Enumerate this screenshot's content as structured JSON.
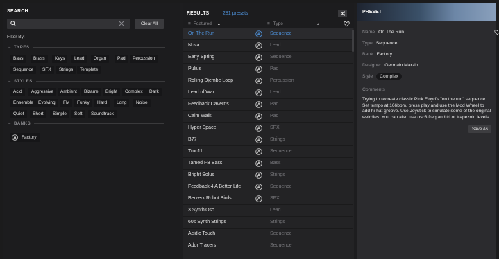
{
  "search": {
    "title": "SEARCH",
    "placeholder": "",
    "clear_all": "Clear All",
    "filter_by": "Filter By:"
  },
  "types": {
    "label": "TYPES",
    "tags": [
      "Bass",
      "Brass",
      "Keys",
      "Lead",
      "Organ",
      "Pad",
      "Percussion",
      "Sequence",
      "SFX",
      "Strings",
      "Template"
    ]
  },
  "styles": {
    "label": "STYLES",
    "tags": [
      "Acid",
      "Aggressive",
      "Ambient",
      "Bizarre",
      "Bright",
      "Complex",
      "Dark",
      "Ensemble",
      "Evolving",
      "FM",
      "Funky",
      "Hard",
      "Long",
      "Noise",
      "Quiet",
      "Short",
      "Simple",
      "Soft",
      "Soundtrack"
    ]
  },
  "banks": {
    "label": "BANKS",
    "items": [
      "Factory"
    ]
  },
  "results": {
    "title": "RESULTS",
    "count": "281 presets",
    "col_featured": "Featured",
    "col_type": "Type",
    "rows": [
      {
        "name": "On The Run",
        "type": "Sequence",
        "factory": true,
        "selected": true
      },
      {
        "name": "Nova",
        "type": "Lead",
        "factory": true
      },
      {
        "name": "Early Spring",
        "type": "Sequence",
        "factory": true
      },
      {
        "name": "Pulius",
        "type": "Pad",
        "factory": true
      },
      {
        "name": "Rolling Djembe Loop",
        "type": "Percussion",
        "factory": true
      },
      {
        "name": "Lead of War",
        "type": "Lead",
        "factory": true
      },
      {
        "name": "Feedback Caverns",
        "type": "Pad",
        "factory": true
      },
      {
        "name": "Calm Walk",
        "type": "Pad",
        "factory": true
      },
      {
        "name": "Hyper Space",
        "type": "SFX",
        "factory": true
      },
      {
        "name": "B77",
        "type": "Strings",
        "factory": true
      },
      {
        "name": "Truc11",
        "type": "Sequence",
        "factory": true
      },
      {
        "name": "Tamed FB Bass",
        "type": "Bass",
        "factory": true
      },
      {
        "name": "Bright Solus",
        "type": "Strings",
        "factory": true
      },
      {
        "name": "Feedback 4 A Better Life",
        "type": "Sequence",
        "factory": true
      },
      {
        "name": "Berzerk Robot Birds",
        "type": "SFX",
        "factory": true
      },
      {
        "name": "3 Synth'Osc",
        "type": "Lead",
        "factory": false
      },
      {
        "name": "60s Synth Strings",
        "type": "Strings",
        "factory": false
      },
      {
        "name": "Acidic Touch",
        "type": "Sequence",
        "factory": false
      },
      {
        "name": "Ador Tracers",
        "type": "Sequence",
        "factory": false
      }
    ]
  },
  "preset": {
    "title": "PRESET",
    "name_label": "Name",
    "name": "On The Run",
    "type_label": "Type",
    "type": "Sequence",
    "bank_label": "Bank",
    "bank": "Factory",
    "designer_label": "Designer",
    "designer": "Germain Marzin",
    "style_label": "Style",
    "style": "Complex",
    "comments_label": "Comments",
    "comments": "Trying to recreate classic PInk Floyd's \"on the run\" sequence. Set tempo at 166bpm, press play and use the Mod Wheel to add hi-hat groove. Use Joystick to simulate some of the original weirdies. You can also use osc3 freq and tri or trapezoid levels.",
    "save_as": "Save As"
  },
  "colors": {
    "accent": "#4d8fd6",
    "panel": "#1c1c1e",
    "list_bg": "#232325",
    "detail_bg": "#2b2b2e"
  }
}
